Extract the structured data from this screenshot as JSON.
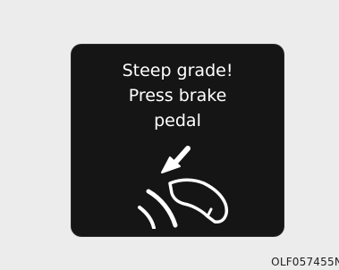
{
  "warning_display": {
    "lines": [
      "Steep grade!",
      "Press brake",
      "pedal"
    ],
    "icon": "brake-pedal-press-icon",
    "background_color": "#151515",
    "text_color": "#ffffff"
  },
  "figure_code": "OLF057455N"
}
